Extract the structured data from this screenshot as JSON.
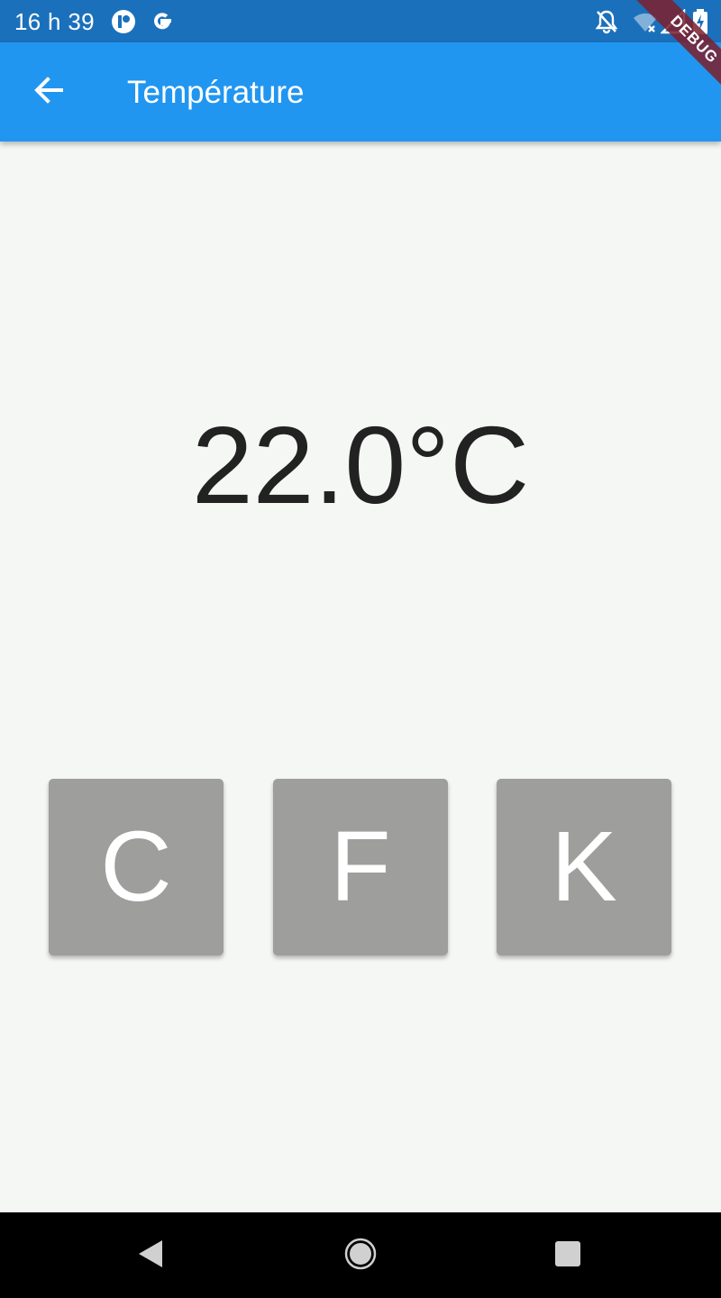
{
  "status_bar": {
    "time": "16 h 39",
    "left_icons": [
      "app-notification-icon",
      "google-icon"
    ],
    "right_icons": [
      "notifications-off-icon",
      "wifi-off-icon",
      "cellular-no-signal-icon",
      "battery-charging-icon"
    ],
    "background_color": "#1b70bb"
  },
  "app_bar": {
    "title": "Température",
    "back_icon": "arrow-back-icon",
    "background_color": "#2196f0"
  },
  "debug_banner": {
    "label": "DEBUG"
  },
  "main": {
    "temperature": "22.0°C",
    "units": [
      {
        "label": "C"
      },
      {
        "label": "F"
      },
      {
        "label": "K"
      }
    ],
    "button_color": "#9e9e9d"
  },
  "nav_bar": {
    "icons": [
      "nav-back-icon",
      "nav-home-icon",
      "nav-recents-icon"
    ]
  }
}
